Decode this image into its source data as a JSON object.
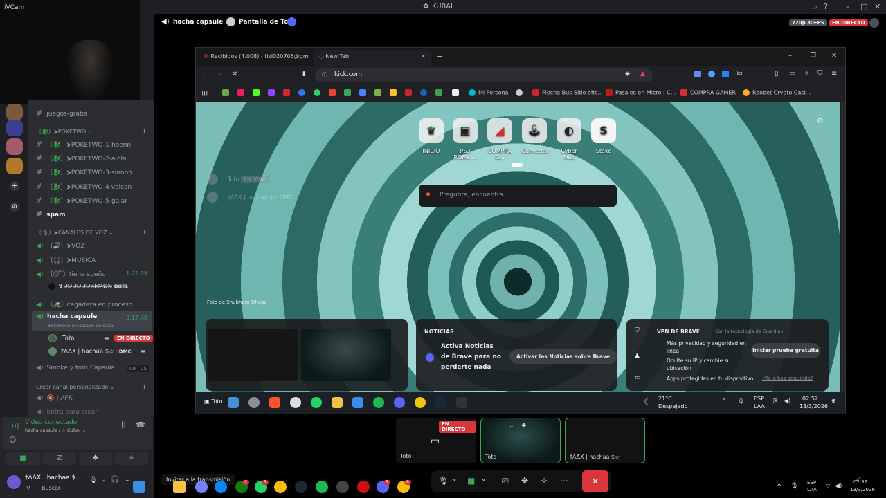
{
  "window": {
    "title": "KURAI",
    "title_prefix": "·",
    "ivcam_label": "iVCam"
  },
  "stage_header": {
    "channel": "hacha capsule",
    "screen": "Pantalla de Toto",
    "quality": "720p 30FPS",
    "live": "EN DIRECTO"
  },
  "channels": {
    "items": [
      {
        "label": "juegos-gratis"
      },
      {
        "label": "spam"
      }
    ],
    "poketwo_category": "〔🐉〕⮞POKETWO",
    "poketwo": [
      "〔🐉〕⮞POKETWO-1-hoenn",
      "〔🐉〕⮞POKETWO-2-alola",
      "〔🐉〕⮞POKETWO-3-sinnoh",
      "〔🐉〕⮞POKETWO-4-volcan",
      "〔🐉〕⮞POKETWO-5-galar"
    ],
    "voice_category": "〔🎙〕⮞CANALES DE VOZ",
    "voz": "〔🔊〕⮞VOZ",
    "musica": "〔🎧〕⮞MUSICA",
    "tiene_sueno": "〔😴〕tiene sueño",
    "tiene_sueno_timer": "1:22:09",
    "tiene_sueno_user": "↯D̶D̶D̶D̶D̶D̶B̶E̶M̶Ø̶N̶",
    "tiene_sueno_badge": "DUEL",
    "cagadera": "〔🚜〕cagadera en proceso",
    "hacha": "hacha capsule",
    "hacha_timer": "3:17:48",
    "hacha_status": "Establece un estado de canal",
    "user_toto": "Toto",
    "user_toto_live": "EN DIRECTO",
    "user_adx": "†ΛΔX | hachaa $☆",
    "user_adx_badge": "DMC",
    "smoke": "Smoke y toto Capsule",
    "smoke_count_a": "00",
    "smoke_count_b": "05",
    "custom_category": "Crear canal personalizado",
    "afk": "🔇 | AFK",
    "entra": "Entra para crear"
  },
  "voice_panel": {
    "status": "Vídeo conectado",
    "channel": "hacha capsule / ☆ KURAI ☆"
  },
  "user": {
    "name": "†ΛΔX | hachaa $...",
    "search": "Buscar"
  },
  "browser": {
    "tabs": [
      {
        "label": "Recibidos (4.008) - tizi020706@gma..."
      },
      {
        "label": "New Tab"
      }
    ],
    "url": "kick.com",
    "bookmarks": [
      "Mi Personal",
      "Flecha Bus Sitio ofic...",
      "Pasajes en Micro | C...",
      "COMPRA GAMER",
      "Roobet Crypto Casi..."
    ],
    "speed_dials": [
      "INICIO",
      "PS3 ROMs ...",
      "COMPRA G...",
      "Gamezfull",
      "Cyber Fest",
      "Stake"
    ],
    "search_placeholder": "Pregunta, encuentra...",
    "photo_credit": "Foto de Shubham Dhage",
    "ghost_user_1": "Toto",
    "ghost_user_1_tag": "EN VIVO",
    "ghost_user_2": "†ΛΔX | hachaa $☆",
    "ghost_user_2_tag": "DMC",
    "news_title": "NOTICIAS",
    "news_body": "Activa Noticias de Brave para no perderte nada",
    "news_button": "Activar las Noticias sobre Brave",
    "vpn_title": "VPN DE BRAVE",
    "vpn_powered": "Con la tecnología de Guardian",
    "vpn_items": [
      "Más privacidad y seguridad en línea",
      "Oculte su IP y cambie su ubicación",
      "Apps protegidas en tu dispositivo"
    ],
    "vpn_button": "Iniciar prueba gratuita",
    "vpn_link": "¿Ya lo has adquirido?",
    "taskbar_user": "Toto",
    "weather_temp": "21°C",
    "weather_desc": "Despejado",
    "lang": "ESP",
    "lang2": "LAA",
    "time": "02:52",
    "date": "13/3/2026"
  },
  "stage_tiles": {
    "screen_live": "EN DIRECTO",
    "screen_user": "Toto",
    "cam1_user": "Toto",
    "cam2_user": "†ΛΔX | hachaa $☆"
  },
  "tooltip": "Invitar a la transmisión",
  "host": {
    "lang": "ESP",
    "lang2": "LAA",
    "time": "02:52",
    "date": "13/3/2026",
    "badges": [
      "1",
      "3",
      "5",
      "8",
      "1"
    ]
  }
}
